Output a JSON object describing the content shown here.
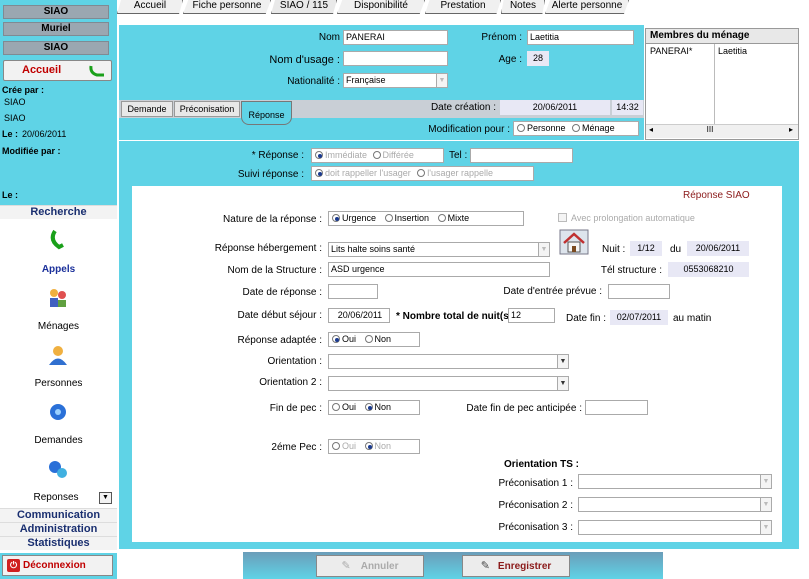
{
  "sidebar": {
    "top_buttons": [
      "SIAO",
      "Muriel",
      "SIAO"
    ],
    "accueil_label": "Accueil",
    "cree_par_label": "Crée par :",
    "cree_par_values": [
      "SIAO",
      "SIAO"
    ],
    "le_label": "Le :",
    "le_value": "20/06/2011",
    "modifiee_par_label": "Modifiée par :",
    "le2_label": "Le :",
    "recherche": "Recherche",
    "nav": [
      "Appels",
      "Ménages",
      "Personnes",
      "Demandes",
      "Reponses"
    ],
    "communication": "Communication",
    "administration": "Administration",
    "statistiques": "Statistiques",
    "deconnexion": "Déconnexion"
  },
  "tabs": [
    "Accueil",
    "Fiche personne",
    "SIAO / 115",
    "Disponibilité",
    "Prestation",
    "Notes",
    "Alerte personne"
  ],
  "header": {
    "nom_label": "Nom",
    "nom_value": "PANERAI",
    "prenom_label": "Prénom :",
    "prenom_value": "Laetitia",
    "nom_usage_label": "Nom d'usage :",
    "nom_usage_value": "",
    "age_label": "Age :",
    "age_value": "28",
    "nationalite_label": "Nationalité :",
    "nationalite_value": "Française",
    "subtabs": [
      "Demande",
      "Préconisation",
      "Réponse"
    ],
    "date_creation_label": "Date création :",
    "date_creation_value": "20/06/2011",
    "heure_value": "14:32",
    "modification_label": "Modification pour :",
    "mod_options": [
      "Personne",
      "Ménage"
    ]
  },
  "members": {
    "title": "Membres du ménage",
    "rows": [
      [
        "PANERAI*",
        "Laetitia"
      ]
    ],
    "scroll_mid": "III"
  },
  "reponse": {
    "reponse_label": "* Réponse :",
    "reponse_options": [
      "Immédiate",
      "Différée"
    ],
    "tel_label": "Tel :",
    "tel_value": "",
    "suivi_label": "Suivi réponse :",
    "suivi_options": [
      "doit rappeller l'usager",
      "l'usager rappelle"
    ],
    "title": "Réponse SIAO",
    "nature_label": "Nature de la réponse :",
    "nature_options": [
      "Urgence",
      "Insertion",
      "Mixte"
    ],
    "prolongation_label": "Avec prolongation automatique",
    "hebergement_label": "Réponse hébergement :",
    "hebergement_value": "Lits halte soins santé",
    "nuit_label": "Nuit :",
    "nuit_value": "1/12",
    "du_label": "du",
    "du_value": "20/06/2011",
    "structure_label": "Nom de la Structure :",
    "structure_value": "ASD urgence",
    "tel_structure_label": "Tél structure :",
    "tel_structure_value": "0553068210",
    "date_reponse_label": "Date de réponse :",
    "date_reponse_value": "",
    "date_entree_label": "Date d'entrée prévue :",
    "date_entree_value": "",
    "date_debut_label": "Date début séjour :",
    "date_debut_value": "20/06/2011",
    "nb_nuits_label": "* Nombre total de nuit(s)",
    "nb_nuits_value": "12",
    "date_fin_label": "Date fin :",
    "date_fin_value": "02/07/2011",
    "au_matin": "au matin",
    "adaptee_label": "Réponse adaptée :",
    "yes_no": [
      "Oui",
      "Non"
    ],
    "orientation_label": "Orientation :",
    "orientation2_label": "Orientation 2 :",
    "fin_pec_label": "Fin de pec :",
    "date_fin_pec_label": "Date fin de pec anticipée :",
    "pec2_label": "2éme Pec :",
    "orientation_ts": "Orientation TS :",
    "preco1": "Préconisation 1 :",
    "preco2": "Préconisation 2 :",
    "preco3": "Préconisation 3 :"
  },
  "actions": {
    "annuler": "Annuler",
    "enregistrer": "Enregistrer"
  }
}
